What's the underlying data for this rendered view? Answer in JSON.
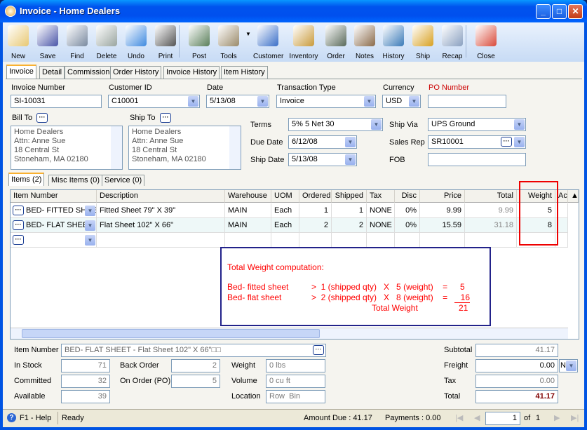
{
  "window": {
    "title": "Invoice - Home Dealers"
  },
  "toolbar": [
    "New",
    "Save",
    "Find",
    "Delete",
    "Undo",
    "Print",
    "Post",
    "Tools",
    "Customer",
    "Inventory",
    "Order",
    "Notes",
    "History",
    "Ship",
    "Recap",
    "Close"
  ],
  "tabs": [
    "Invoice",
    "Detail",
    "Commission",
    "Order History",
    "Invoice History",
    "Item History"
  ],
  "header": {
    "invoice_number_label": "Invoice Number",
    "invoice_number": "SI-10031",
    "customer_id_label": "Customer ID",
    "customer_id": "C10001",
    "date_label": "Date",
    "date": "5/13/08",
    "transaction_type_label": "Transaction Type",
    "transaction_type": "Invoice",
    "currency_label": "Currency",
    "currency": "USD",
    "po_number_label": "PO Number",
    "po_number": "",
    "bill_to_label": "Bill To",
    "bill_to": [
      "Home Dealers",
      "Attn: Anne Sue",
      "18 Central St",
      "Stoneham, MA 02180"
    ],
    "ship_to_label": "Ship To",
    "ship_to": [
      "Home Dealers",
      "Attn: Anne Sue",
      "18 Central St",
      "Stoneham, MA 02180"
    ],
    "terms_label": "Terms",
    "terms": "5% 5 Net 30",
    "due_date_label": "Due Date",
    "due_date": "6/12/08",
    "ship_date_label": "Ship Date",
    "ship_date": "5/13/08",
    "ship_via_label": "Ship Via",
    "ship_via": "UPS Ground",
    "sales_rep_label": "Sales Rep",
    "sales_rep": "SR10001",
    "fob_label": "FOB",
    "fob": ""
  },
  "item_tabs": [
    "Items (2)",
    "Misc Items (0)",
    "Service (0)"
  ],
  "grid": {
    "columns": [
      "Item Number",
      "Description",
      "Warehouse",
      "UOM",
      "Ordered",
      "Shipped",
      "Tax",
      "Disc",
      "Price",
      "Total",
      "Weight",
      "Ac"
    ],
    "rows": [
      [
        "BED- FITTED SHEE",
        "Fitted Sheet 79\" X 39\"",
        "MAIN",
        "Each",
        "1",
        "1",
        "NONE",
        "0%",
        "9.99",
        "9.99",
        "5"
      ],
      [
        "BED- FLAT SHEET",
        "Flat Sheet 102\" X 66\"",
        "MAIN",
        "Each",
        "2",
        "2",
        "NONE",
        "0%",
        "15.59",
        "31.18",
        "8"
      ]
    ]
  },
  "annotation": {
    "title": "Total Weight computation:",
    "line1": {
      "name": "Bed- fitted sheet",
      "calc": ">  1 (shipped qty)   X   5 (weight)    =",
      "result": "5"
    },
    "line2": {
      "name": "Bed- flat sheet",
      "calc": ">  2 (shipped qty)   X   8 (weight)    =",
      "result": "16"
    },
    "total_label": "Total Weight",
    "total": "21",
    "color": "#ff0000"
  },
  "footer": {
    "item_number_label": "Item Number",
    "item_number": "BED- FLAT SHEET - Flat Sheet 102\" X 66\"□□",
    "in_stock_label": "In Stock",
    "in_stock": "71",
    "committed_label": "Committed",
    "committed": "32",
    "available_label": "Available",
    "available": "39",
    "back_order_label": "Back Order",
    "back_order": "2",
    "on_order_label": "On Order (PO)",
    "on_order": "5",
    "weight_label": "Weight",
    "weight": "0 lbs",
    "volume_label": "Volume",
    "volume": "0 cu ft",
    "location_label": "Location",
    "location": "Row  Bin",
    "subtotal_label": "Subtotal",
    "subtotal": "41.17",
    "freight_label": "Freight",
    "freight": "0.00",
    "freight_code": "N",
    "tax_label": "Tax",
    "tax": "0.00",
    "total_label": "Total",
    "total": "41.17"
  },
  "status": {
    "help": "F1 - Help",
    "state": "Ready",
    "amount_due": "Amount Due : 41.17",
    "payments": "Payments : 0.00",
    "page": "1",
    "of": "of",
    "pages": "1"
  }
}
